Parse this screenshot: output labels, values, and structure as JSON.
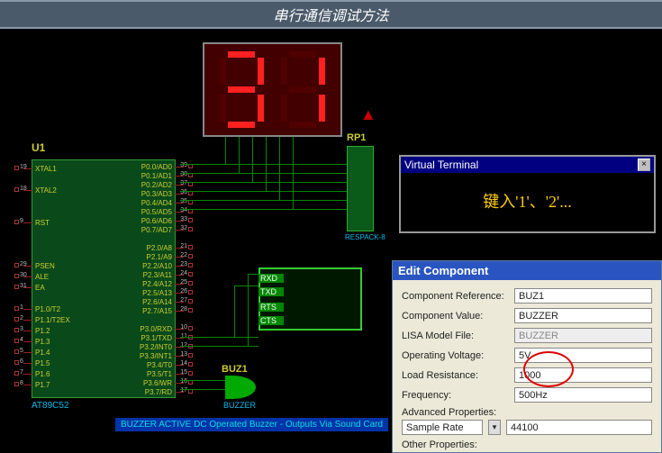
{
  "title": "串行通信调试方法",
  "chip": {
    "ref": "U1",
    "name": "AT89C52",
    "left_pins": [
      "XTAL1",
      "",
      "XTAL2",
      "",
      "",
      "RST",
      "",
      "",
      "",
      "PSEN",
      "ALE",
      "EA",
      "",
      "P1.0/T2",
      "P1.1/T2EX",
      "P1.2",
      "P1.3",
      "P1.4",
      "P1.5",
      "P1.6",
      "P1.7"
    ],
    "right_pins": [
      "P0.0/AD0",
      "P0.1/AD1",
      "P0.2/AD2",
      "P0.3/AD3",
      "P0.4/AD4",
      "P0.5/AD5",
      "P0.6/AD6",
      "P0.7/AD7",
      "",
      "P2.0/A8",
      "P2.1/A9",
      "P2.2/A10",
      "P2.3/A11",
      "P2.4/A12",
      "P2.5/A13",
      "P2.6/A14",
      "P2.7/A15",
      "",
      "P3.0/RXD",
      "P3.1/TXD",
      "P3.2/INT0",
      "P3.3/INT1",
      "P3.4/T0",
      "P3.5/T1",
      "P3.6/WR",
      "P3.7/RD"
    ],
    "left_nums": [
      "19",
      "",
      "18",
      "",
      "",
      "9",
      "",
      "",
      "",
      "29",
      "30",
      "31",
      "",
      "1",
      "2",
      "3",
      "4",
      "5",
      "6",
      "7",
      "8"
    ],
    "right_nums": [
      "39",
      "38",
      "37",
      "36",
      "35",
      "34",
      "33",
      "32",
      "",
      "21",
      "22",
      "23",
      "24",
      "25",
      "26",
      "27",
      "28",
      "",
      "10",
      "11",
      "12",
      "13",
      "14",
      "15",
      "16",
      "17"
    ]
  },
  "rp1": {
    "ref": "RP1",
    "name": "RESPACK-8"
  },
  "buzzer": {
    "ref": "BUZ1",
    "name": "BUZZER"
  },
  "serial": {
    "rxd": "RXD",
    "txd": "TXD",
    "rts": "RTS",
    "cts": "CTS"
  },
  "vt": {
    "title": "Virtual Terminal",
    "text": "键入'1'、'2'..."
  },
  "ec": {
    "title": "Edit Component",
    "fields": {
      "ref_label": "Component Reference:",
      "ref_value": "BUZ1",
      "val_label": "Component Value:",
      "val_value": "BUZZER",
      "lisa_label": "LISA Model File:",
      "lisa_value": "BUZZER",
      "ov_label": "Operating Voltage:",
      "ov_value": "5V",
      "lr_label": "Load Resistance:",
      "lr_value": "1000",
      "freq_label": "Frequency:",
      "freq_value": "500Hz",
      "adv_label": "Advanced Properties:",
      "sr_label": "Sample Rate",
      "sr_value": "44100",
      "other_label": "Other Properties:"
    }
  },
  "status": "BUZZER     ACTIVE     DC Operated Buzzer - Outputs Via Sound Card",
  "display": {
    "digit1": "3",
    "digit2": "1"
  }
}
